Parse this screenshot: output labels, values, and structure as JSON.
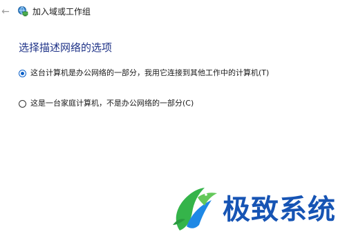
{
  "titlebar": {
    "back_icon": "back-arrow-icon",
    "wizard_icon": "network-domain-icon",
    "title": "加入域或工作组"
  },
  "main": {
    "heading": "选择描述网络的选项",
    "options": [
      {
        "label": "这台计算机是办公网络的一部分，我用它连接到其他工作中的计算机(T)",
        "checked": true
      },
      {
        "label": "这是一台家庭计算机，不是办公网络的一部分(C)",
        "checked": false
      }
    ]
  },
  "watermark": {
    "logo_icon": "dragon-logo-icon",
    "text": "极致系统"
  },
  "colors": {
    "heading": "#1e3287",
    "radio_selected": "#0a5fc8",
    "watermark_text": "#1654b4",
    "watermark_green": "#35b44a"
  }
}
